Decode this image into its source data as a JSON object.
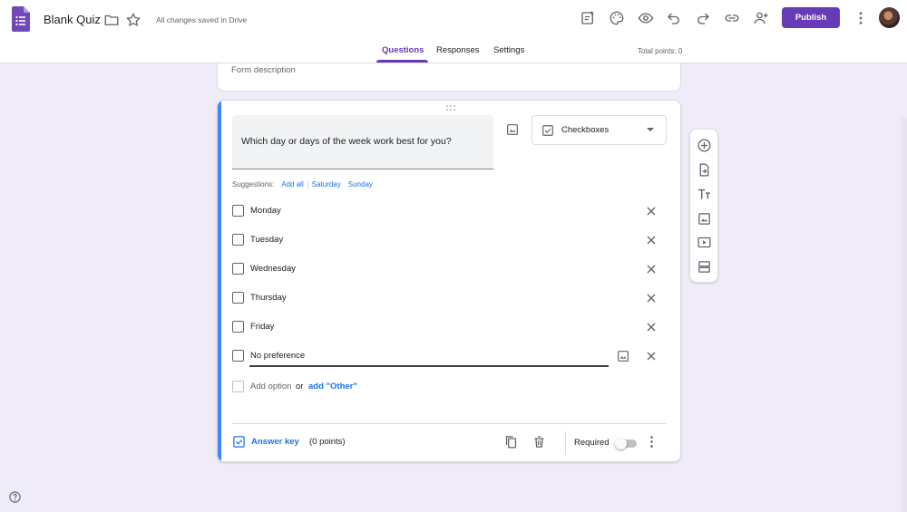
{
  "header": {
    "title": "Blank Quiz",
    "save_status": "All changes saved in Drive",
    "publish_label": "Publish",
    "icons": [
      "forms-app-icon",
      "folder-icon",
      "star-icon",
      "addon-icon",
      "palette-icon",
      "preview-eye-icon",
      "undo-icon",
      "redo-icon",
      "link-icon",
      "add-collaborator-icon",
      "more-vert-icon"
    ]
  },
  "tabs": [
    {
      "label": "Questions",
      "active": true
    },
    {
      "label": "Responses",
      "active": false
    },
    {
      "label": "Settings",
      "active": false
    }
  ],
  "total_points": "Total points: 0",
  "description_placeholder": "Form description",
  "question": {
    "text": "Which day or days of the week work best for you?",
    "type": "Checkboxes",
    "suggestions_label": "Suggestions:",
    "suggestions": [
      "Add all",
      "Saturday",
      "Sunday"
    ],
    "options": [
      "Monday",
      "Tuesday",
      "Wednesday",
      "Thursday",
      "Friday",
      "No preference"
    ],
    "add_option": "Add option",
    "or": "or",
    "add_other": "add \"Other\"",
    "answer_key": "Answer key",
    "points": "(0 points)",
    "required_label": "Required",
    "required": false
  },
  "colors": {
    "accent": "#673ab7",
    "active_question": "#4285f4",
    "link": "#1a73e8",
    "background": "#f0ebf8"
  },
  "side_toolbar": [
    "add-question-icon",
    "import-questions-icon",
    "add-title-icon",
    "add-image-icon",
    "add-video-icon",
    "add-section-icon"
  ]
}
